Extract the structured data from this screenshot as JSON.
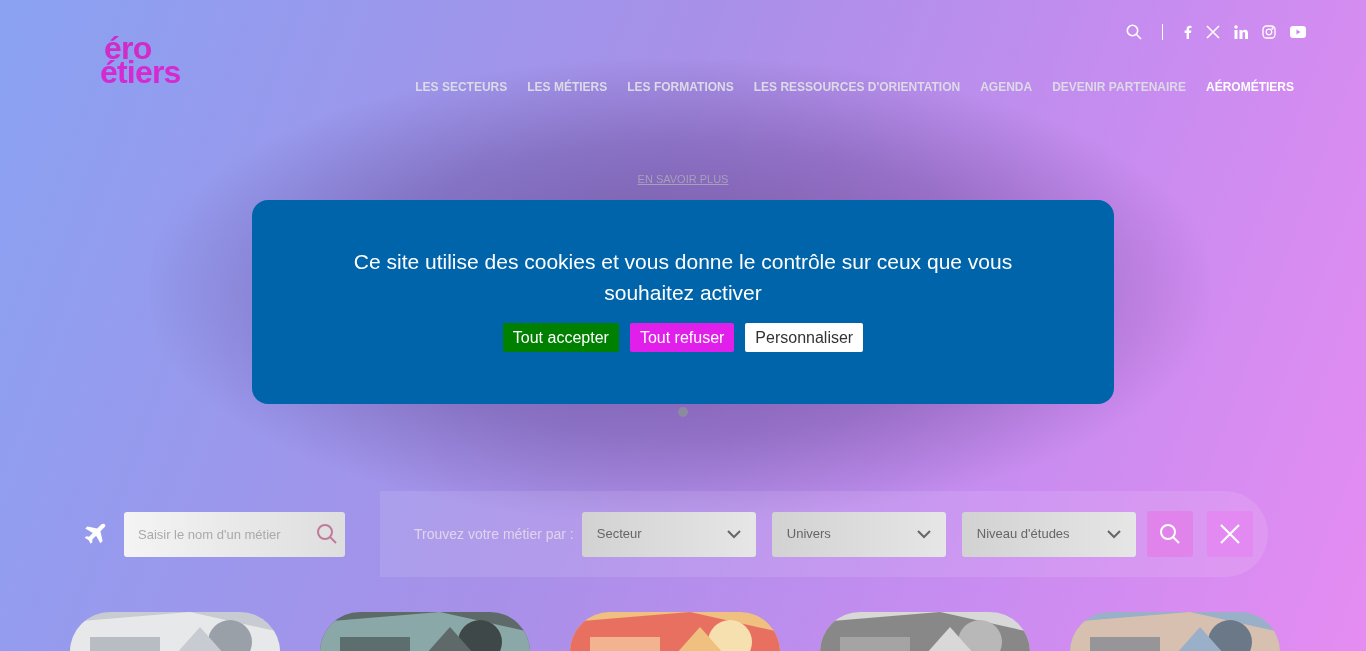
{
  "logo": {
    "lines": [
      "éro",
      "étiers"
    ]
  },
  "nav": [
    {
      "label": "LES SECTEURS"
    },
    {
      "label": "LES MÉTIERS"
    },
    {
      "label": "LES FORMATIONS"
    },
    {
      "label": "LES RESSOURCES D'ORIENTATION"
    },
    {
      "label": "AGENDA"
    },
    {
      "label": "DEVENIR PARTENAIRE"
    },
    {
      "label": "AÉROMÉTIERS",
      "kind": "highlight"
    }
  ],
  "hero": {
    "link": "EN SAVOIR PLUS",
    "dots": [
      {
        "selected": true
      }
    ]
  },
  "cookie_banner": {
    "message": "Ce site utilise des cookies et vous donne le contrôle sur ceux que vous souhaitez activer",
    "buttons": [
      {
        "label": "Tout accepter",
        "kind": "accept"
      },
      {
        "label": "Tout refuser",
        "kind": "refuse"
      },
      {
        "label": "Personnaliser",
        "kind": "customize"
      }
    ]
  },
  "search": {
    "placeholder": "Saisir le nom d'un métier",
    "filter_label": "Trouvez votre métier par :",
    "dropdowns": [
      {
        "label": "Secteur"
      },
      {
        "label": "Univers"
      },
      {
        "label": "Niveau d'études"
      }
    ]
  }
}
